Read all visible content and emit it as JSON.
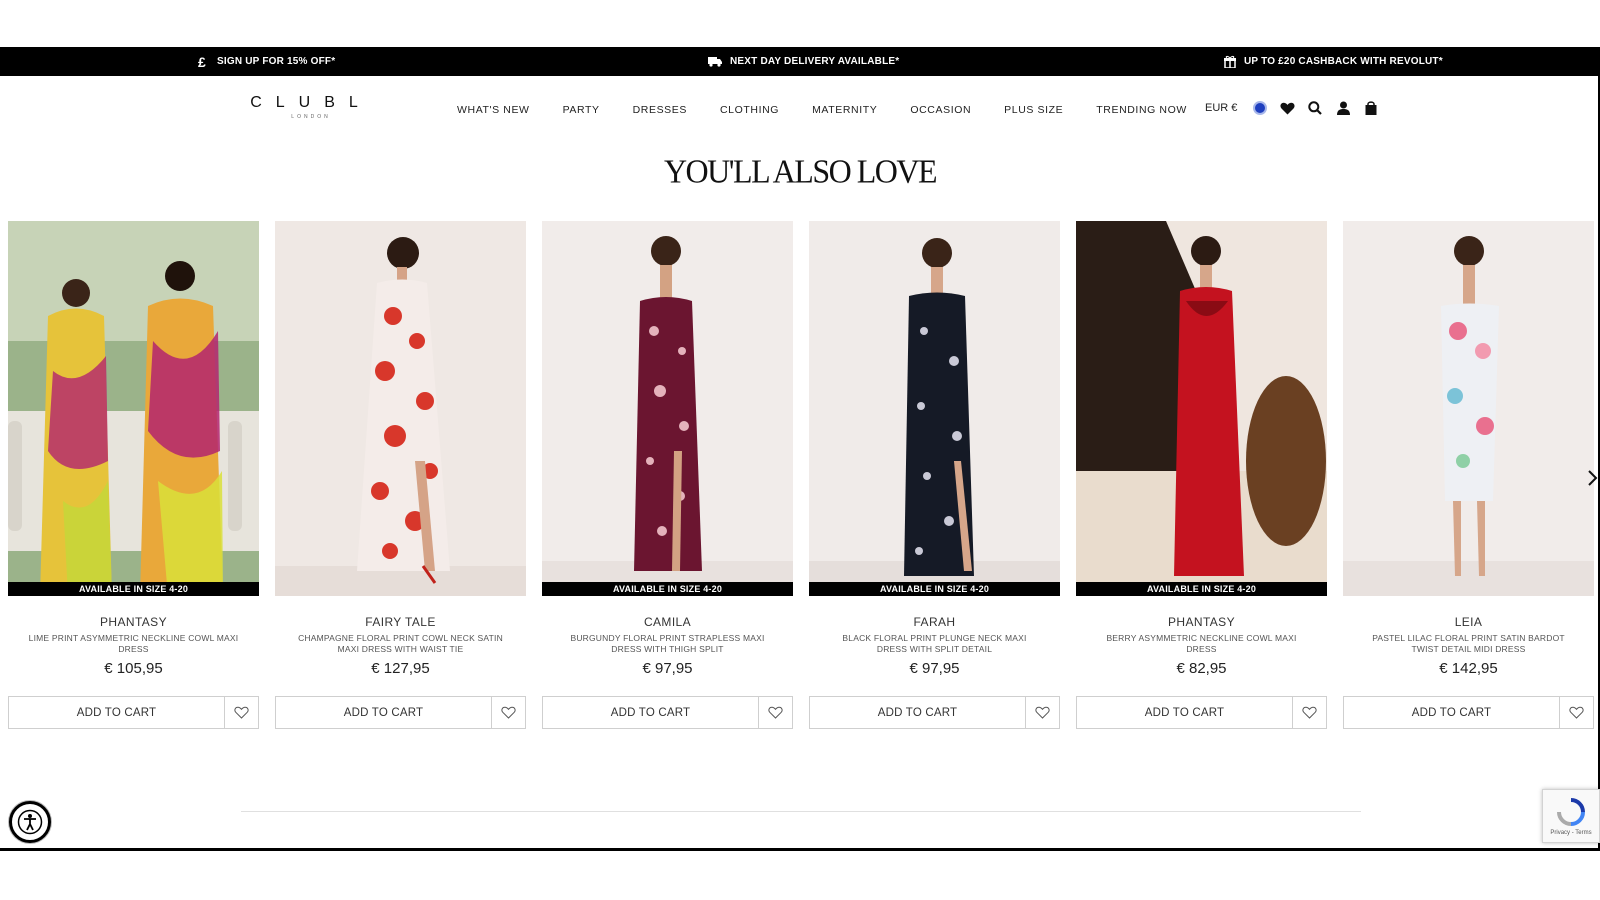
{
  "promo_bar": {
    "items": [
      {
        "icon": "pound-icon",
        "text": "SIGN UP FOR 15% OFF*"
      },
      {
        "icon": "delivery-truck-icon",
        "text": "NEXT DAY DELIVERY AVAILABLE*"
      },
      {
        "icon": "gift-icon",
        "text": "UP TO £20 CASHBACK WITH REVOLUT*"
      }
    ]
  },
  "header": {
    "logo_main": "CLUBL",
    "logo_sub": "LONDON",
    "nav": [
      "WHAT'S NEW",
      "PARTY",
      "DRESSES",
      "CLOTHING",
      "MATERNITY",
      "OCCASION",
      "PLUS SIZE",
      "TRENDING NOW"
    ],
    "currency": "EUR €",
    "icons": [
      "flag-icon",
      "heart-icon",
      "search-icon",
      "account-icon",
      "bag-icon"
    ]
  },
  "section": {
    "title": "YOU'LL ALSO LOVE"
  },
  "products": [
    {
      "name": "PHANTASY",
      "desc": "LIME PRINT ASYMMETRIC NECKLINE COWL MAXI DRESS",
      "price": "€ 105,95",
      "badge": "AVAILABLE IN SIZE 4-20",
      "cta": "ADD TO CART",
      "colors": [
        "#e6c33a",
        "#b3246f"
      ]
    },
    {
      "name": "FAIRY TALE",
      "desc": "CHAMPAGNE FLORAL PRINT COWL NECK SATIN MAXI DRESS WITH WAIST TIE",
      "price": "€ 127,95",
      "badge": "",
      "cta": "ADD TO CART",
      "colors": [
        "#f1e9e6",
        "#d8372b"
      ]
    },
    {
      "name": "CAMILA",
      "desc": "BURGUNDY FLORAL PRINT STRAPLESS MAXI DRESS WITH THIGH SPLIT",
      "price": "€ 97,95",
      "badge": "AVAILABLE IN SIZE 4-20",
      "cta": "ADD TO CART",
      "colors": [
        "#6b1530",
        "#e4b2bb"
      ]
    },
    {
      "name": "FARAH",
      "desc": "BLACK FLORAL PRINT PLUNGE NECK MAXI DRESS WITH SPLIT DETAIL",
      "price": "€ 97,95",
      "badge": "AVAILABLE IN SIZE 4-20",
      "cta": "ADD TO CART",
      "colors": [
        "#151a26",
        "#c9c9d6"
      ]
    },
    {
      "name": "PHANTASY",
      "desc": "BERRY ASYMMETRIC NECKLINE COWL MAXI DRESS",
      "price": "€ 82,95",
      "badge": "AVAILABLE IN SIZE 4-20",
      "cta": "ADD TO CART",
      "colors": [
        "#c4121f",
        "#8a0b14"
      ]
    },
    {
      "name": "LEIA",
      "desc": "PASTEL LILAC FLORAL PRINT SATIN BARDOT TWIST DETAIL MIDI DRESS",
      "price": "€ 142,95",
      "badge": "",
      "cta": "ADD TO CART",
      "colors": [
        "#eef0f4",
        "#e9708f"
      ]
    }
  ],
  "recaptcha": {
    "text": "Privacy - Terms"
  },
  "colors": {
    "promo_bg": "#000000",
    "badge_bg": "#000000",
    "flag": "#1f3fbf"
  }
}
